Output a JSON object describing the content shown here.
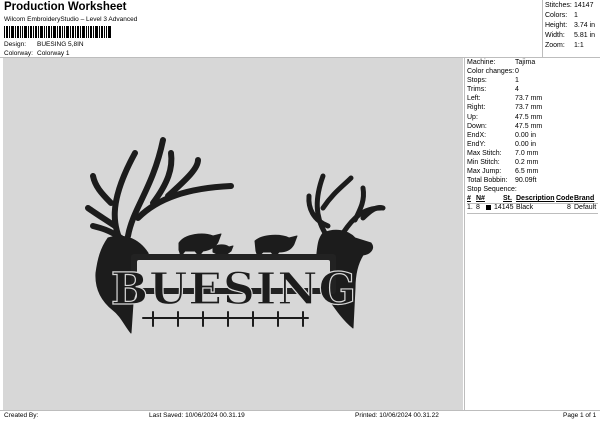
{
  "header": {
    "title": "Production Worksheet",
    "subtitle": "Wilcom EmbroideryStudio – Level 3 Advanced",
    "design_label": "Design:",
    "design_value": "BUESING 5,8IN",
    "colorway_label": "Colorway:",
    "colorway_value": "Colorway 1"
  },
  "summary": [
    {
      "label": "Stitches:",
      "value": "14147"
    },
    {
      "label": "Colors:",
      "value": "1"
    },
    {
      "label": "Height:",
      "value": "3.74 in"
    },
    {
      "label": "Width:",
      "value": "5.81 in"
    },
    {
      "label": "Zoom:",
      "value": "1:1"
    }
  ],
  "machine_info": [
    {
      "label": "Machine:",
      "value": "Tajima"
    },
    {
      "label": "Color changes:",
      "value": "0"
    },
    {
      "label": "Stops:",
      "value": "1"
    },
    {
      "label": "Trims:",
      "value": "4"
    },
    {
      "label": "Left:",
      "value": "73.7 mm"
    },
    {
      "label": "Right:",
      "value": "73.7 mm"
    },
    {
      "label": "Up:",
      "value": "47.5 mm"
    },
    {
      "label": "Down:",
      "value": "47.5 mm"
    },
    {
      "label": "EndX:",
      "value": "0.00 in"
    },
    {
      "label": "EndY:",
      "value": "0.00 in"
    },
    {
      "label": "Max Stitch:",
      "value": "7.0 mm"
    },
    {
      "label": "Min Stitch:",
      "value": "0.2 mm"
    },
    {
      "label": "Max Jump:",
      "value": "6.5 mm"
    },
    {
      "label": "Total Bobbin:",
      "value": "90.09ft"
    }
  ],
  "stop_sequence": {
    "label": "Stop Sequence:",
    "columns": {
      "num": "#",
      "n": "N#",
      "st": "St.",
      "desc": "Description",
      "code": "Code",
      "brand": "Brand"
    },
    "rows": [
      {
        "num": "1.",
        "n": "8",
        "st": "14145",
        "desc": "Black",
        "code": "8",
        "brand": "Default",
        "color": "#000000"
      }
    ]
  },
  "design_text": "BUESING",
  "footer": {
    "created": "Created By:",
    "saved": "Last Saved: 10/06/2024 00.31.19",
    "printed": "Printed: 10/06/2024 00.31.22",
    "page": "Page 1 of 1"
  },
  "colors": {
    "canvas": "#d7d7d7",
    "thread": "#1c1c1c"
  }
}
